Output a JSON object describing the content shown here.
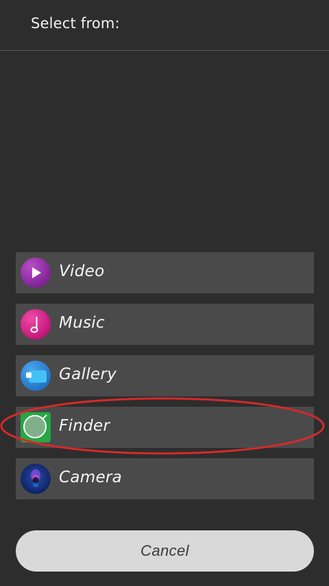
{
  "header": {
    "title": "Select from:"
  },
  "options": [
    {
      "label": "Video",
      "icon": "video-app-icon",
      "color": "#8e2aa3"
    },
    {
      "label": "Music",
      "icon": "music-app-icon",
      "color": "#d81b8a"
    },
    {
      "label": "Gallery",
      "icon": "gallery-app-icon",
      "color": "#2e86d6"
    },
    {
      "label": "Finder",
      "icon": "finder-app-icon",
      "color": "#27a745"
    },
    {
      "label": "Camera",
      "icon": "camera-app-icon",
      "color": "#13327a"
    }
  ],
  "cancel": {
    "label": "Cancel"
  },
  "colors": {
    "background": "#2d2d2d",
    "item_background": "#4a4a4a",
    "highlight_ring": "#d42a2a"
  }
}
